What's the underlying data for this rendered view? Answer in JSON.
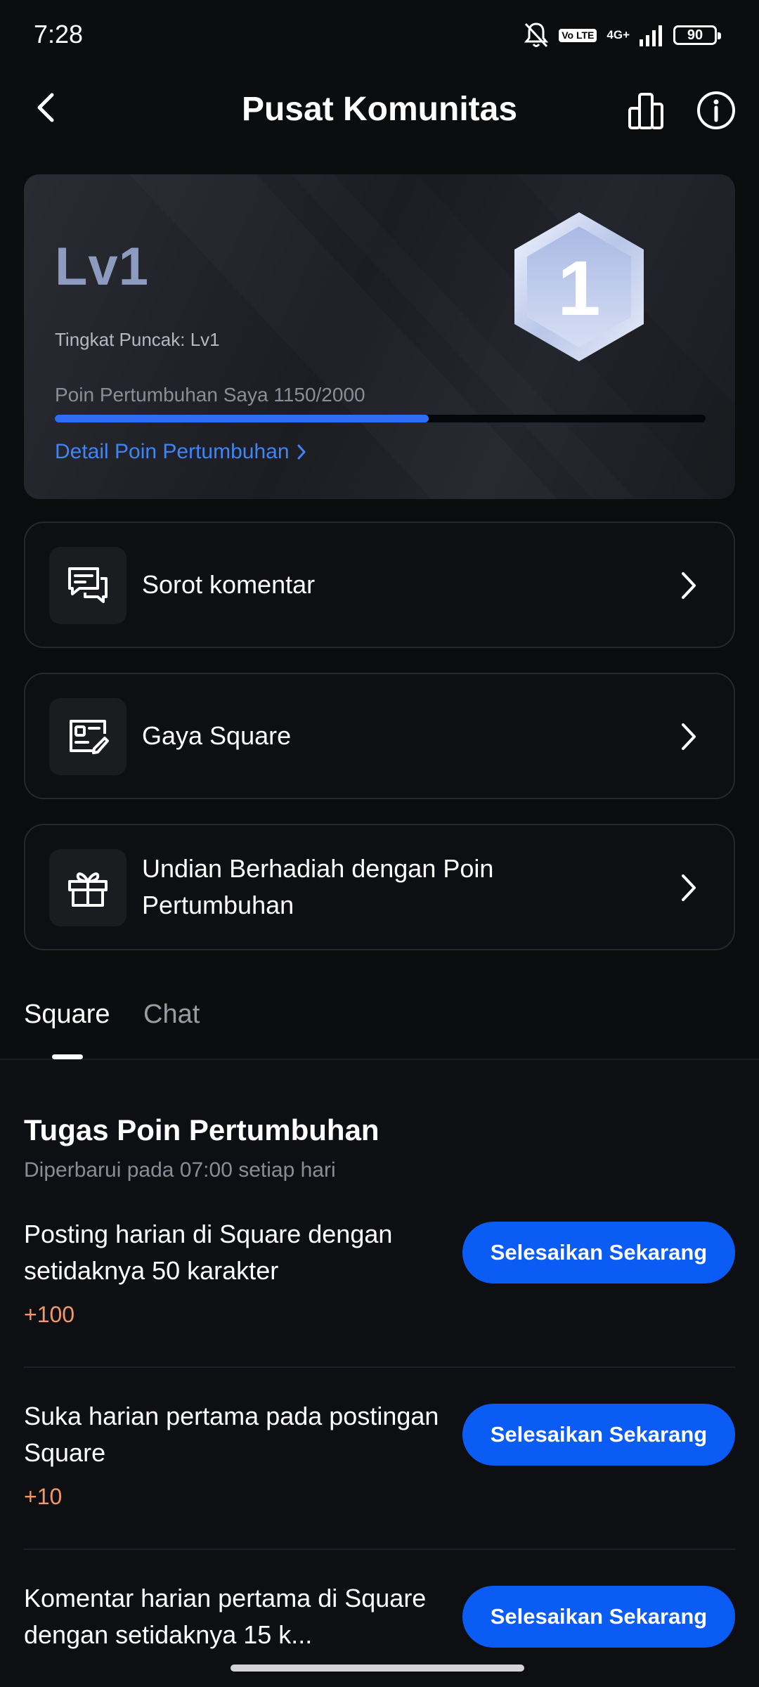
{
  "status_bar": {
    "time": "7:28",
    "volte": "Vo LTE",
    "network": "4G+",
    "battery": "90"
  },
  "header": {
    "title": "Pusat Komunitas",
    "icons": [
      "back-icon",
      "leaderboard-icon",
      "info-icon"
    ]
  },
  "level_card": {
    "level": "Lv1",
    "peak_level": "Tingkat Puncak: Lv1",
    "points_text": "Poin Pertumbuhan Saya 1150/2000",
    "points_current": 1150,
    "points_max": 2000,
    "detail_link": "Detail Poin Pertumbuhan",
    "badge_number": "1",
    "accent_color": "#2f6df5"
  },
  "menu": [
    {
      "label": "Sorot komentar",
      "icon": "comment-highlight-icon"
    },
    {
      "label": "Gaya Square",
      "icon": "profile-edit-icon"
    },
    {
      "label": "Undian Berhadiah dengan Poin Pertumbuhan",
      "icon": "gift-icon"
    }
  ],
  "tabs": [
    {
      "label": "Square",
      "active": true
    },
    {
      "label": "Chat",
      "active": false
    }
  ],
  "tasks": {
    "title": "Tugas Poin Pertumbuhan",
    "subtitle": "Diperbarui pada 07:00 setiap hari",
    "button_label": "Selesaikan Sekarang",
    "items": [
      {
        "text": "Posting harian di Square dengan setidaknya 50 karakter",
        "points": "+100"
      },
      {
        "text": "Suka harian pertama pada postingan Square",
        "points": "+10"
      },
      {
        "text": "Komentar harian pertama di Square dengan setidaknya 15 k...",
        "points": ""
      }
    ],
    "button_color": "#0b5cf5",
    "points_color": "#f0976b"
  }
}
